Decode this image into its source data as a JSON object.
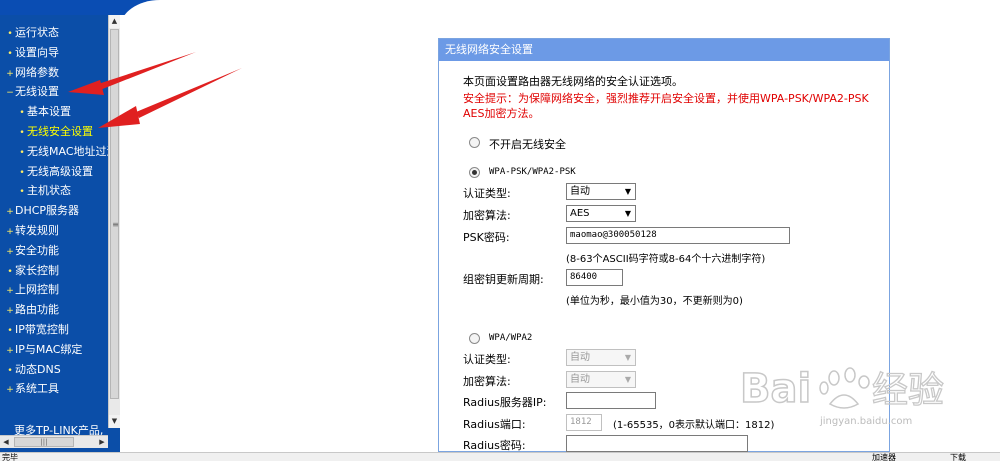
{
  "sidebar": {
    "items": [
      {
        "label": "运行状态",
        "bullet": "•"
      },
      {
        "label": "设置向导",
        "bullet": "•"
      },
      {
        "label": "网络参数",
        "bullet": "+"
      },
      {
        "label": "无线设置",
        "bullet": "−"
      },
      {
        "label": "基本设置",
        "bullet": "•"
      },
      {
        "label": "无线安全设置",
        "bullet": "•"
      },
      {
        "label": "无线MAC地址过滤",
        "bullet": "•"
      },
      {
        "label": "无线高级设置",
        "bullet": "•"
      },
      {
        "label": "主机状态",
        "bullet": "•"
      },
      {
        "label": "DHCP服务器",
        "bullet": "+"
      },
      {
        "label": "转发规则",
        "bullet": "+"
      },
      {
        "label": "安全功能",
        "bullet": "+"
      },
      {
        "label": "家长控制",
        "bullet": "•"
      },
      {
        "label": "上网控制",
        "bullet": "+"
      },
      {
        "label": "路由功能",
        "bullet": "+"
      },
      {
        "label": "IP带宽控制",
        "bullet": "•"
      },
      {
        "label": "IP与MAC绑定",
        "bullet": "+"
      },
      {
        "label": "动态DNS",
        "bullet": "•"
      },
      {
        "label": "系统工具",
        "bullet": "+"
      }
    ],
    "more": "更多TP-LINK产品,",
    "scroll_grip": "≡",
    "hscroll_grip": "|||"
  },
  "panel": {
    "title": "无线网络安全设置",
    "description": "本页面设置路由器无线网络的安全认证选项。",
    "warning": "安全提示：为保障网络安全，强烈推荐开启安全设置，并使用WPA-PSK/WPA2-PSK AES加密方法。",
    "option_none": "不开启无线安全",
    "option_psk": "WPA-PSK/WPA2-PSK",
    "psk": {
      "auth_label": "认证类型:",
      "auth_value": "自动",
      "enc_label": "加密算法:",
      "enc_value": "AES",
      "key_label": "PSK密码:",
      "key_value": "maomao@300050128",
      "key_hint": "(8-63个ASCII码字符或8-64个十六进制字符)",
      "interval_label": "组密钥更新周期:",
      "interval_value": "86400",
      "interval_hint": "(单位为秒，最小值为30，不更新则为0)"
    },
    "option_wpa": "WPA/WPA2",
    "wpa": {
      "auth_label": "认证类型:",
      "auth_value": "自动",
      "enc_label": "加密算法:",
      "enc_value": "自动",
      "server_label": "Radius服务器IP:",
      "port_label": "Radius端口:",
      "port_value": "1812",
      "port_hint": "(1-65535，0表示默认端口：1812)",
      "secret_label": "Radius密码:"
    }
  },
  "statusbar": {
    "left": "完毕",
    "right1": "加速器",
    "right2": "下载"
  },
  "watermark": {
    "brand_latin": "Bai",
    "brand_cn": "经验",
    "url": "jingyan.baidu.com"
  },
  "colors": {
    "sidebar_bg": "#0b4ea8",
    "panel_header": "#6c9ae6",
    "warning_text": "#e00000",
    "active_item": "#ffff00",
    "annotation_arrow": "#e02020"
  }
}
